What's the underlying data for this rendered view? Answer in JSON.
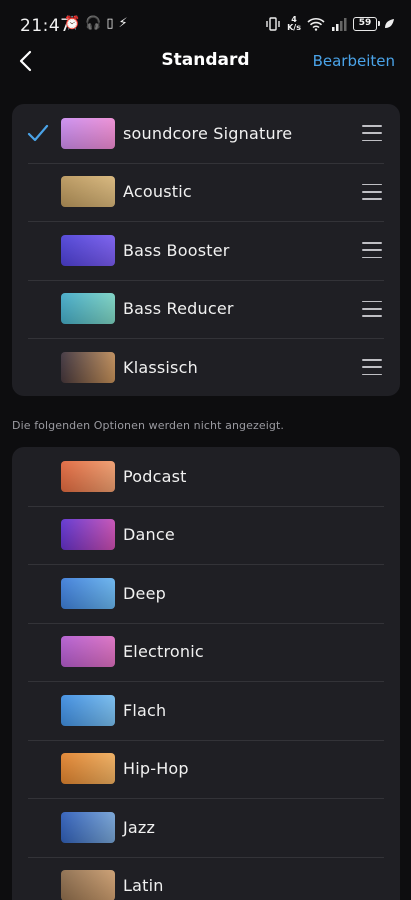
{
  "status_bar": {
    "time": "21:47",
    "net_speed_value": "4",
    "net_speed_unit": "K/s",
    "battery": "59"
  },
  "nav": {
    "title": "Standard",
    "edit_label": "Bearbeiten"
  },
  "visible_presets": [
    {
      "label": "soundcore Signature",
      "selected": true,
      "colors": [
        "#c98cf0",
        "#f08bd0"
      ]
    },
    {
      "label": "Acoustic",
      "selected": false,
      "colors": [
        "#b8955a",
        "#d9b77a"
      ]
    },
    {
      "label": "Bass Booster",
      "selected": false,
      "colors": [
        "#4a3fd6",
        "#7a5cf0"
      ]
    },
    {
      "label": "Bass Reducer",
      "selected": false,
      "colors": [
        "#3fa8c8",
        "#7fd6c2"
      ]
    },
    {
      "label": "Klassisch",
      "selected": false,
      "colors": [
        "#3a2f3a",
        "#c9935a"
      ]
    }
  ],
  "section_note": "Die folgenden Optionen werden nicht angezeigt.",
  "hidden_presets": [
    {
      "label": "Podcast",
      "colors": [
        "#e0643a",
        "#f0a070"
      ]
    },
    {
      "label": "Dance",
      "colors": [
        "#5a2fd0",
        "#d04fb0"
      ]
    },
    {
      "label": "Deep",
      "colors": [
        "#3a7ad8",
        "#6ab8f0"
      ]
    },
    {
      "label": "Electronic",
      "colors": [
        "#b05ad0",
        "#e070c0"
      ]
    },
    {
      "label": "Flach",
      "colors": [
        "#3a8ae0",
        "#7ac0f0"
      ]
    },
    {
      "label": "Hip-Hop",
      "colors": [
        "#e0802a",
        "#f0b060"
      ]
    },
    {
      "label": "Jazz",
      "colors": [
        "#2a5ab8",
        "#7aa8d8"
      ]
    },
    {
      "label": "Latin",
      "colors": [
        "#8a6a4a",
        "#d0a070"
      ]
    }
  ],
  "colors": {
    "accent": "#4aa3e8",
    "background": "#0d0d0f",
    "card": "#1f1f24"
  }
}
